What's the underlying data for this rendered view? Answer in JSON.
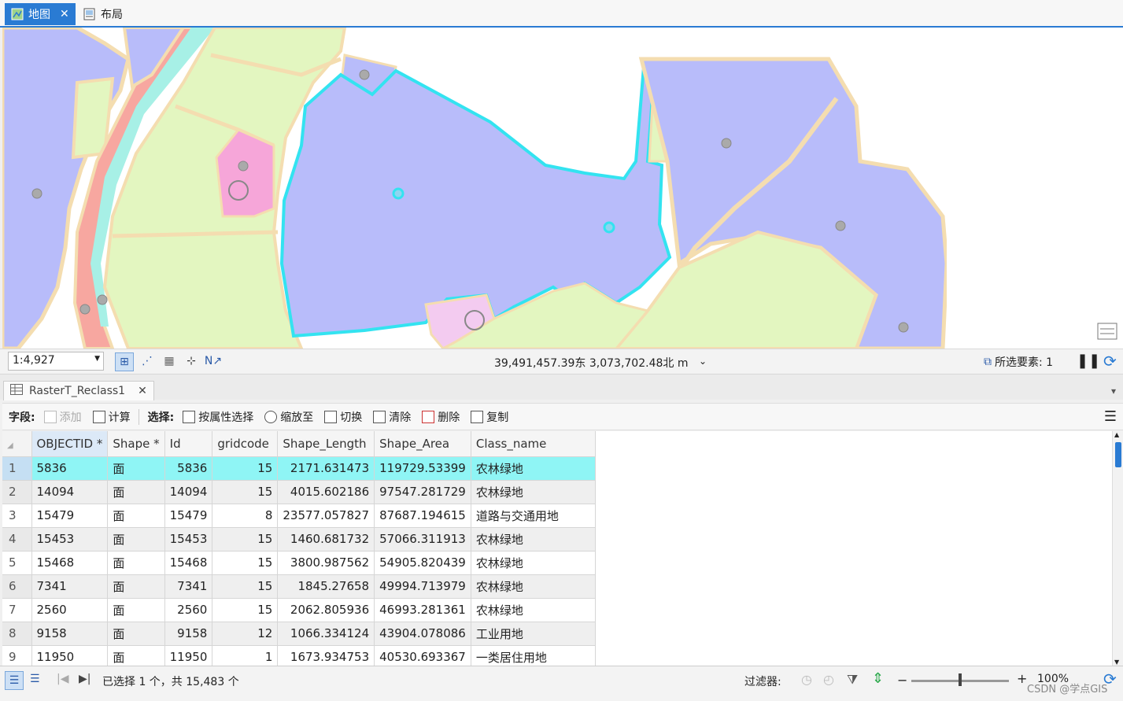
{
  "doc_tabs": [
    {
      "label": "地图",
      "active": true
    },
    {
      "label": "布局",
      "active": false
    }
  ],
  "map": {
    "scale": "1:4,927",
    "coordinates": "39,491,457.39东 3,073,702.48北 m",
    "selected_features_label": "所选要素: 1",
    "colors": {
      "farmland": "#b8bcfa",
      "green": "#e3f6c0",
      "road": "#f4ddb0",
      "residential": "#f7a7a0",
      "industrial": "#f6a6d9",
      "water": "#a7f0e6",
      "selection": "#33e3f0"
    }
  },
  "attribute_table": {
    "tab_label": "RasterT_Reclass1",
    "toolbar": {
      "fields_label": "字段:",
      "add_label": "添加",
      "calculate_label": "计算",
      "selection_label": "选择:",
      "select_by_attr_label": "按属性选择",
      "zoom_to_label": "缩放至",
      "switch_label": "切换",
      "clear_label": "清除",
      "delete_label": "删除",
      "copy_label": "复制"
    },
    "columns": [
      "OBJECTID *",
      "Shape *",
      "Id",
      "gridcode",
      "Shape_Length",
      "Shape_Area",
      "Class_name"
    ],
    "rows": [
      [
        "1",
        "5836",
        "面",
        "5836",
        "15",
        "2171.631473",
        "119729.53399",
        "农林绿地"
      ],
      [
        "2",
        "14094",
        "面",
        "14094",
        "15",
        "4015.602186",
        "97547.281729",
        "农林绿地"
      ],
      [
        "3",
        "15479",
        "面",
        "15479",
        "8",
        "23577.057827",
        "87687.194615",
        "道路与交通用地"
      ],
      [
        "4",
        "15453",
        "面",
        "15453",
        "15",
        "1460.681732",
        "57066.311913",
        "农林绿地"
      ],
      [
        "5",
        "15468",
        "面",
        "15468",
        "15",
        "3800.987562",
        "54905.820439",
        "农林绿地"
      ],
      [
        "6",
        "7341",
        "面",
        "7341",
        "15",
        "1845.27658",
        "49994.713979",
        "农林绿地"
      ],
      [
        "7",
        "2560",
        "面",
        "2560",
        "15",
        "2062.805936",
        "46993.281361",
        "农林绿地"
      ],
      [
        "8",
        "9158",
        "面",
        "9158",
        "12",
        "1066.334124",
        "43904.078086",
        "工业用地"
      ],
      [
        "9",
        "11950",
        "面",
        "11950",
        "1",
        "1673.934753",
        "40530.693367",
        "一类居住用地"
      ]
    ],
    "selected_row_index": 0
  },
  "status": {
    "selection_text": "已选择 1 个，共 15,483 个",
    "filter_label": "过滤器:",
    "zoom": "100%",
    "zoom_minus": "−",
    "zoom_plus": "+"
  },
  "watermark": "CSDN @学点GIS"
}
